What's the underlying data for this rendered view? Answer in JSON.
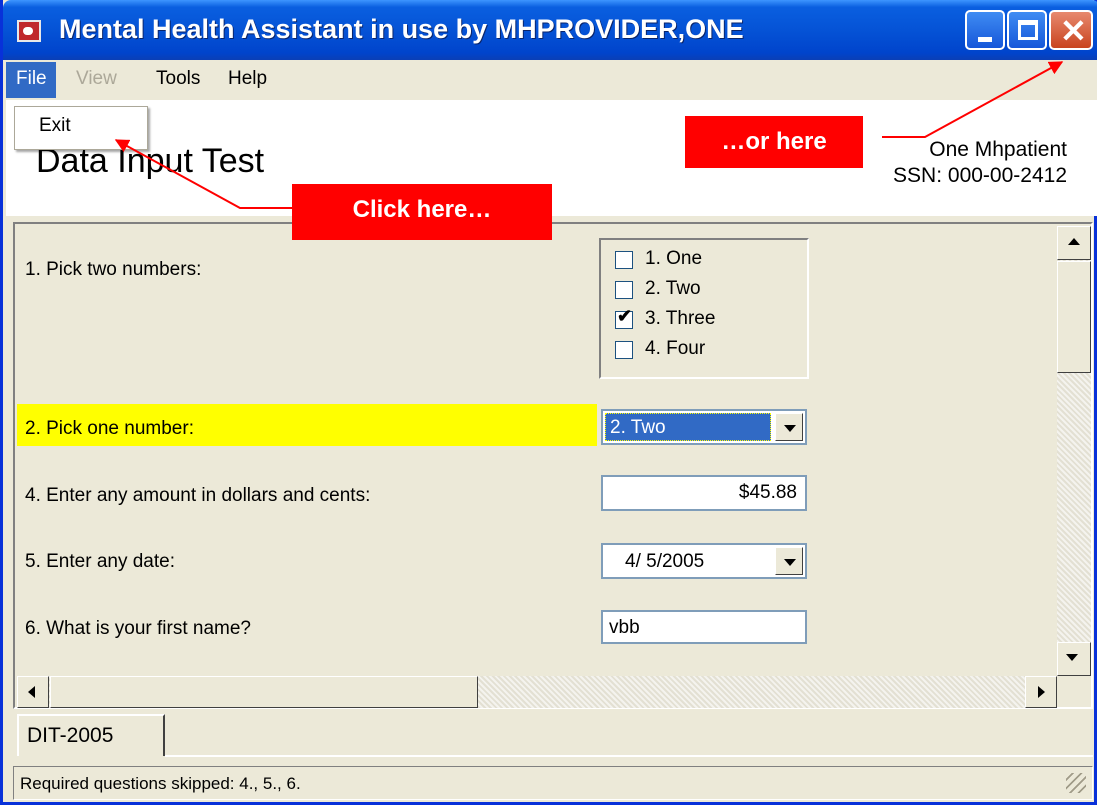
{
  "window": {
    "title": "Mental Health Assistant in use by MHPROVIDER,ONE"
  },
  "menubar": {
    "file": "File",
    "view": "View",
    "tools": "Tools",
    "help": "Help"
  },
  "file_menu": {
    "exit": "Exit"
  },
  "header": {
    "title": "Data Input Test",
    "patient_name": "One Mhpatient",
    "patient_ssn": "SSN: 000-00-2412"
  },
  "annotations": {
    "callout_1": "…or here",
    "callout_2": "Click here…",
    "color": "#ff0000"
  },
  "questions": {
    "q1": {
      "label": "1. Pick two numbers:",
      "options": [
        {
          "label": "1. One",
          "checked": false
        },
        {
          "label": "2. Two",
          "checked": false
        },
        {
          "label": "3. Three",
          "checked": true
        },
        {
          "label": "4. Four",
          "checked": false
        }
      ]
    },
    "q2": {
      "label": "2. Pick one number:",
      "selected": "2. Two",
      "highlight": "#ffff00"
    },
    "q4": {
      "label": "4. Enter any amount in dollars and cents:",
      "value": "$45.88"
    },
    "q5": {
      "label": "5. Enter any date:",
      "value": "4/ 5/2005"
    },
    "q6": {
      "label": "6. What is your first name?",
      "value": "vbb"
    }
  },
  "tabs": [
    {
      "label": "DIT-2005"
    }
  ],
  "status": {
    "text": "Required questions skipped: 4., 5., 6."
  },
  "icons": {
    "close": "close-icon",
    "minimize": "minimize-icon",
    "maximize": "maximize-icon",
    "check": "checkmark-icon"
  }
}
